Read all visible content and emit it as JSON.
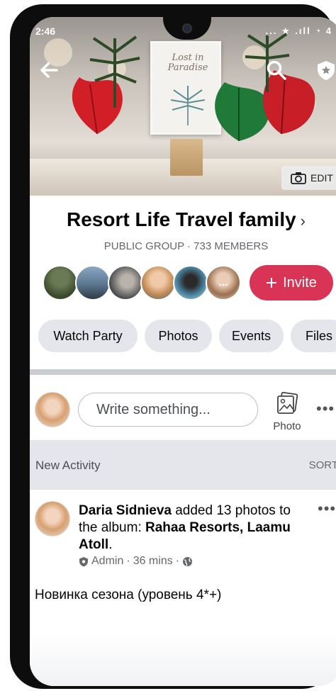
{
  "status_bar": {
    "time": "2:46",
    "icons": "... ★ .ıll ◔ 4"
  },
  "cover": {
    "frame_text": "Lost in Paradise",
    "edit_label": "EDIT"
  },
  "group": {
    "title": "Resort Life Travel family",
    "meta": "PUBLIC GROUP · 733 MEMBERS",
    "invite_label": "Invite",
    "more_members_label": "..."
  },
  "chips": [
    "Watch Party",
    "Photos",
    "Events",
    "Files"
  ],
  "composer": {
    "placeholder": "Write something...",
    "photo_label": "Photo"
  },
  "activity": {
    "title": "New Activity",
    "sort_label": "SORT"
  },
  "post": {
    "author": "Daria Sidnieva",
    "action": " added 13 photos to the album: ",
    "album": "Rahaa Resorts, Laamu Atoll",
    "after_album": ".",
    "role": "Admin",
    "time": "36 mins",
    "body": "Новинка сезона (уровень 4*+)"
  },
  "colors": {
    "accent": "#d93455",
    "chip_bg": "#e4e6eb",
    "text_primary": "#050505",
    "text_secondary": "#65676b"
  },
  "icons": [
    "back-arrow-icon",
    "search-icon",
    "shield-star-icon",
    "camera-icon",
    "plus-icon",
    "photo-gallery-icon",
    "more-icon",
    "admin-shield-icon",
    "globe-icon",
    "chevron-right-icon"
  ]
}
